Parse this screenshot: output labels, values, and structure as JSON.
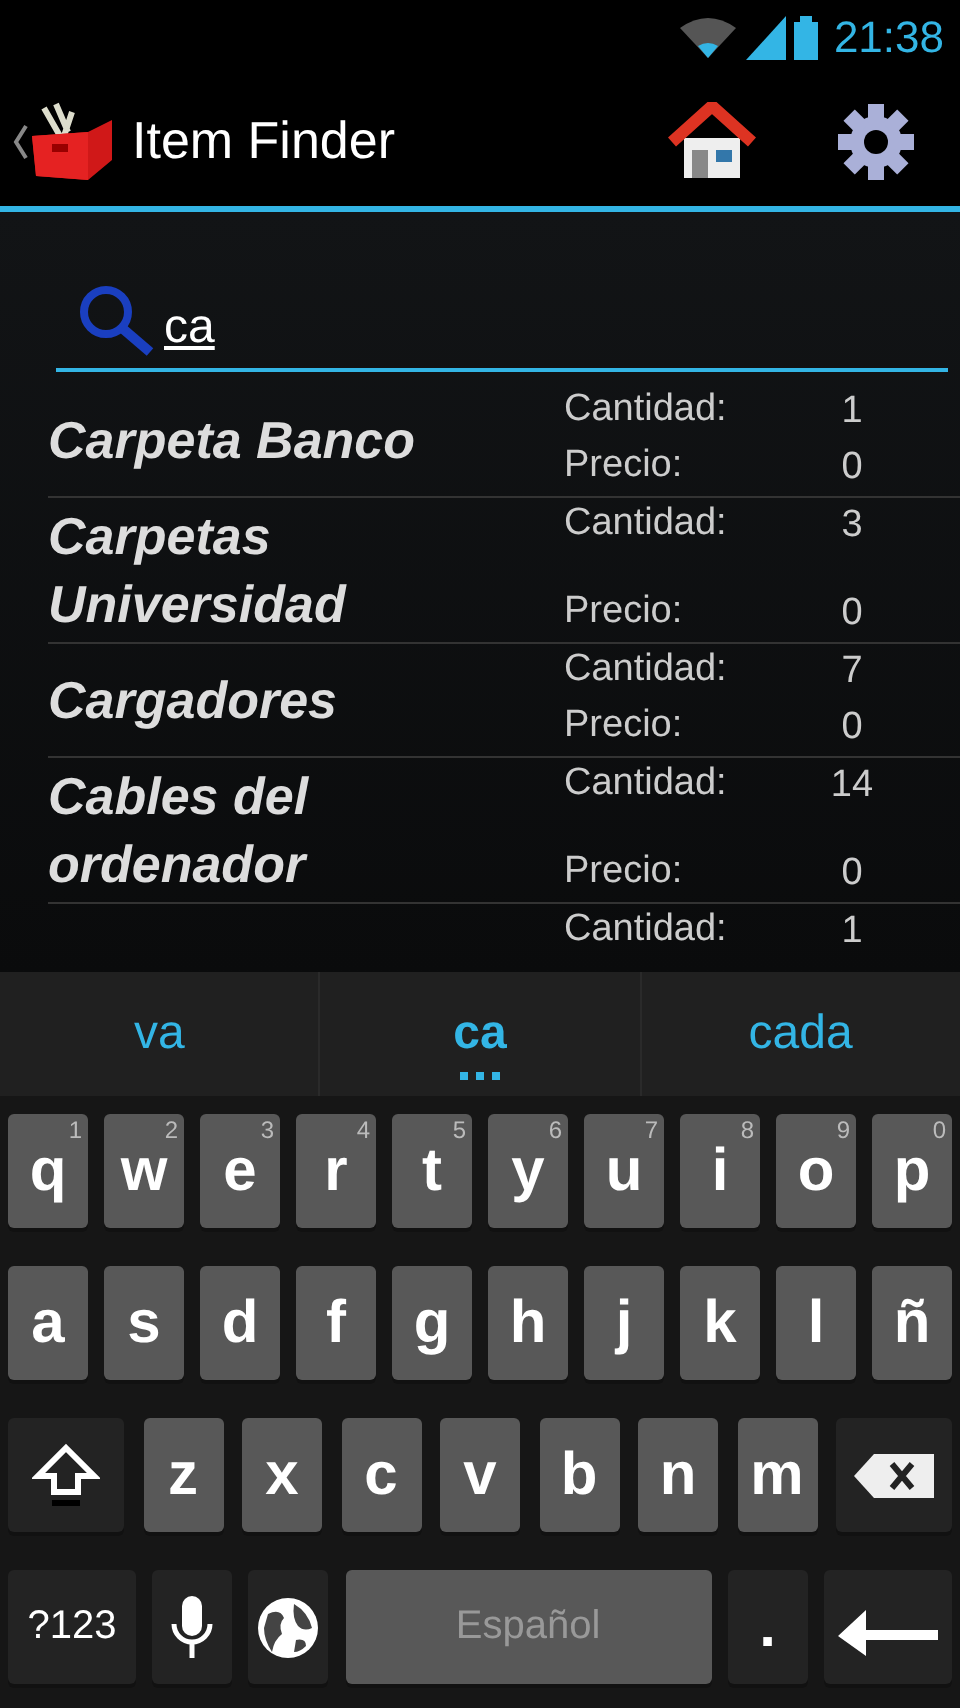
{
  "status_bar": {
    "time": "21:38"
  },
  "action_bar": {
    "title": "Item Finder"
  },
  "search": {
    "value": "ca"
  },
  "items": [
    {
      "name": "Carpeta Banco",
      "quantity_label": "Cantidad:",
      "quantity": "1",
      "price_label": "Precio:",
      "price": "0"
    },
    {
      "name": "Carpetas Universidad",
      "quantity_label": "Cantidad:",
      "quantity": "3",
      "price_label": "Precio:",
      "price": "0"
    },
    {
      "name": "Cargadores",
      "quantity_label": "Cantidad:",
      "quantity": "7",
      "price_label": "Precio:",
      "price": "0"
    },
    {
      "name": "Cables del ordenador",
      "quantity_label": "Cantidad:",
      "quantity": "14",
      "price_label": "Precio:",
      "price": "0"
    },
    {
      "quantity_label": "Cantidad:",
      "quantity": "1"
    }
  ],
  "suggestions": [
    {
      "text": "va",
      "selected": false
    },
    {
      "text": "ca",
      "selected": true
    },
    {
      "text": "cada",
      "selected": false
    }
  ],
  "keyboard": {
    "rows": [
      {
        "keys": [
          {
            "kind": "letter",
            "label": "q",
            "hint": "1"
          },
          {
            "kind": "letter",
            "label": "w",
            "hint": "2"
          },
          {
            "kind": "letter",
            "label": "e",
            "hint": "3"
          },
          {
            "kind": "letter",
            "label": "r",
            "hint": "4"
          },
          {
            "kind": "letter",
            "label": "t",
            "hint": "5"
          },
          {
            "kind": "letter",
            "label": "y",
            "hint": "6"
          },
          {
            "kind": "letter",
            "label": "u",
            "hint": "7"
          },
          {
            "kind": "letter",
            "label": "i",
            "hint": "8"
          },
          {
            "kind": "letter",
            "label": "o",
            "hint": "9"
          },
          {
            "kind": "letter",
            "label": "p",
            "hint": "0"
          }
        ]
      },
      {
        "keys": [
          {
            "kind": "letter",
            "label": "a"
          },
          {
            "kind": "letter",
            "label": "s"
          },
          {
            "kind": "letter",
            "label": "d"
          },
          {
            "kind": "letter",
            "label": "f"
          },
          {
            "kind": "letter",
            "label": "g"
          },
          {
            "kind": "letter",
            "label": "h"
          },
          {
            "kind": "letter",
            "label": "j"
          },
          {
            "kind": "letter",
            "label": "k"
          },
          {
            "kind": "letter",
            "label": "l"
          },
          {
            "kind": "letter",
            "label": "ñ"
          }
        ]
      },
      {
        "keys": [
          {
            "kind": "shift"
          },
          {
            "kind": "letter",
            "label": "z"
          },
          {
            "kind": "letter",
            "label": "x"
          },
          {
            "kind": "letter",
            "label": "c"
          },
          {
            "kind": "letter",
            "label": "v"
          },
          {
            "kind": "letter",
            "label": "b"
          },
          {
            "kind": "letter",
            "label": "n"
          },
          {
            "kind": "letter",
            "label": "m"
          },
          {
            "kind": "backspace"
          }
        ]
      },
      {
        "keys": [
          {
            "kind": "symbols",
            "label": "?123"
          },
          {
            "kind": "mic"
          },
          {
            "kind": "globe"
          },
          {
            "kind": "space",
            "label": "Español"
          },
          {
            "kind": "period",
            "label": "."
          },
          {
            "kind": "enter"
          }
        ]
      }
    ]
  }
}
